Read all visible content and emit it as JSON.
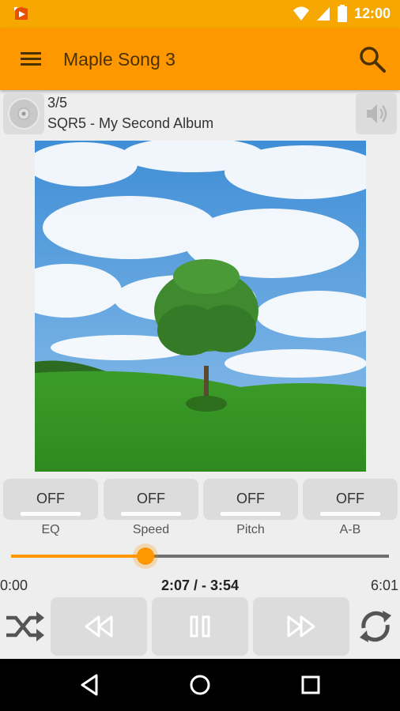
{
  "status_bar": {
    "time": "12:00",
    "icons": [
      "app-notification-icon",
      "wifi-icon",
      "signal-icon",
      "battery-icon"
    ]
  },
  "app_bar": {
    "title": "Maple Song 3",
    "menu_icon": "hamburger-menu-icon",
    "search_icon": "search-icon"
  },
  "track_info": {
    "index": "3/5",
    "album": "SQR5 - My Second Album",
    "disc_icon": "disc-icon",
    "volume_icon": "volume-icon"
  },
  "toggles": [
    {
      "value": "OFF",
      "label": "EQ"
    },
    {
      "value": "OFF",
      "label": "Speed"
    },
    {
      "value": "OFF",
      "label": "Pitch"
    },
    {
      "value": "OFF",
      "label": "A-B"
    }
  ],
  "playback": {
    "start": "0:00",
    "current": "2:07 / - 3:54",
    "end": "6:01",
    "progress": 0.355
  },
  "transport": {
    "shuffle_icon": "shuffle-icon",
    "rewind_icon": "rewind-icon",
    "pause_icon": "pause-icon",
    "forward_icon": "fast-forward-icon",
    "repeat_icon": "repeat-icon"
  },
  "nav_bar": [
    "back-icon",
    "home-icon",
    "recents-icon"
  ],
  "colors": {
    "accent": "#ff9800",
    "status_bar": "#f7a800",
    "button_bg": "#dcdcdc"
  }
}
